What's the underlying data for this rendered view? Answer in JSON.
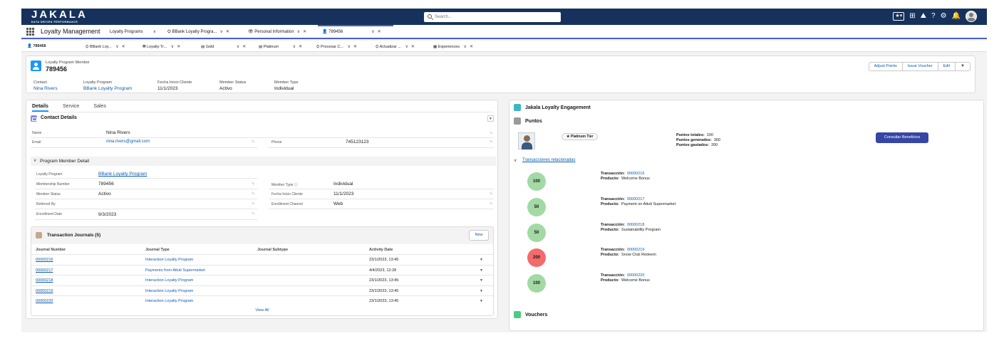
{
  "header": {
    "logo_main": "JAKALA",
    "logo_sub": "DATA DRIVEN PERFORMANCE",
    "search_placeholder": "Search..."
  },
  "app_nav": {
    "app_name": "Loyalty Management",
    "items": [
      {
        "label": "Loyalty Programs"
      },
      {
        "label": "BBank Loyalty Progra..."
      },
      {
        "label": "Personal Information"
      },
      {
        "label": "789456"
      }
    ]
  },
  "sub_tabs": [
    {
      "label": "789456"
    },
    {
      "label": "BBank Loy..."
    },
    {
      "label": "Loyalty Tr..."
    },
    {
      "label": "Gold"
    },
    {
      "label": "Platinum"
    },
    {
      "label": "Procesar C..."
    },
    {
      "label": "Actualizar ..."
    },
    {
      "label": "Experiences"
    }
  ],
  "record": {
    "type": "Loyalty Program Member",
    "name": "789456",
    "buttons": [
      "Adjust Points",
      "Issue Voucher",
      "Edit"
    ],
    "highlights": [
      {
        "label": "Contact",
        "value": "Nina Rivers"
      },
      {
        "label": "Loyalty Program",
        "value": "BBank Loyalty Program"
      },
      {
        "label": "Fecha Inicio Cliente",
        "value": "11/1/2023"
      },
      {
        "label": "Member Status",
        "value": "Activo"
      },
      {
        "label": "Member Type",
        "value": "Individual"
      }
    ]
  },
  "details": {
    "tabs": [
      "Details",
      "Service",
      "Sales"
    ],
    "contact_title": "Contact Details",
    "contact": {
      "name_label": "Name",
      "name_value": "Nina Rivers",
      "email_label": "Email",
      "email_value": "nina.rivers@gmail.com",
      "phone_label": "Phone",
      "phone_value": "745123123"
    },
    "program_title": "Program Member Detail",
    "program": {
      "loyalty_program_label": "Loyalty Program",
      "loyalty_program_value": "BBank Loyalty Program",
      "membership_number_label": "Membership Number",
      "membership_number_value": "789456",
      "member_status_label": "Member Status",
      "member_status_value": "Activo",
      "referred_by_label": "Referred By",
      "referred_by_value": "",
      "enrollment_date_label": "Enrollment Date",
      "enrollment_date_value": "9/3/2023",
      "member_type_label": "Member Type",
      "member_type_value": "Individual",
      "fecha_label": "Fecha Inicio Cliente",
      "fecha_value": "11/1/2023",
      "channel_label": "Enrollment Channel",
      "channel_value": "Web"
    }
  },
  "journals": {
    "title": "Transaction Journals (5)",
    "new_label": "New",
    "columns": [
      "Journal Number",
      "Journal Type",
      "Journal Subtype",
      "Activity Date"
    ],
    "rows": [
      {
        "number": "00000216",
        "type": "Interaction Loyalty Program",
        "subtype": "",
        "date": "23/1/2023, 13:45"
      },
      {
        "number": "00000217",
        "type": "Payments from Attuti Supermarket",
        "subtype": "",
        "date": "4/4/2023, 12:28"
      },
      {
        "number": "00000218",
        "type": "Interaction Loyalty Program",
        "subtype": "",
        "date": "23/1/2023, 13:45"
      },
      {
        "number": "00000219",
        "type": "Interaction Loyalty Program",
        "subtype": "",
        "date": "23/1/2023, 13:45"
      },
      {
        "number": "00000220",
        "type": "Interaction Loyalty Program",
        "subtype": "",
        "date": "23/1/2023, 13:45"
      }
    ],
    "view_all": "View All"
  },
  "engagement": {
    "title": "Jakala Loyalty Engagement",
    "puntos_title": "Puntos",
    "tier": "Platinum Tier",
    "totales_label": "Puntos totales:",
    "totales_value": "100",
    "generados_label": "Puntos generados:",
    "generados_value": "300",
    "gastados_label": "Puntos gastados:",
    "gastados_value": "200",
    "consult_button": "Consultar Beneficios",
    "transactions_link": "Transacciones relacionadas",
    "transaction_label": "Transacción:",
    "product_label": "Producto:",
    "transactions": [
      {
        "points": "100",
        "number": "00000216",
        "product": "Welcome Bonus",
        "color": "#a3d9a5"
      },
      {
        "points": "50",
        "number": "00000217",
        "product": "Payment on Attuti Supermarket",
        "color": "#a3d9a5"
      },
      {
        "points": "50",
        "number": "00000218",
        "product": "Sustainability Program",
        "color": "#a3d9a5"
      },
      {
        "points": "200",
        "number": "00000219",
        "product": "Snow Club Redeem",
        "color": "#f36b6b"
      },
      {
        "points": "100",
        "number": "00000220",
        "product": "Welcome Bonus",
        "color": "#a3d9a5"
      }
    ],
    "vouchers_title": "Vouchers"
  },
  "colors": {
    "brand_header": "#16325c",
    "accent": "#1b96ff",
    "button_primary": "#3646a6"
  }
}
